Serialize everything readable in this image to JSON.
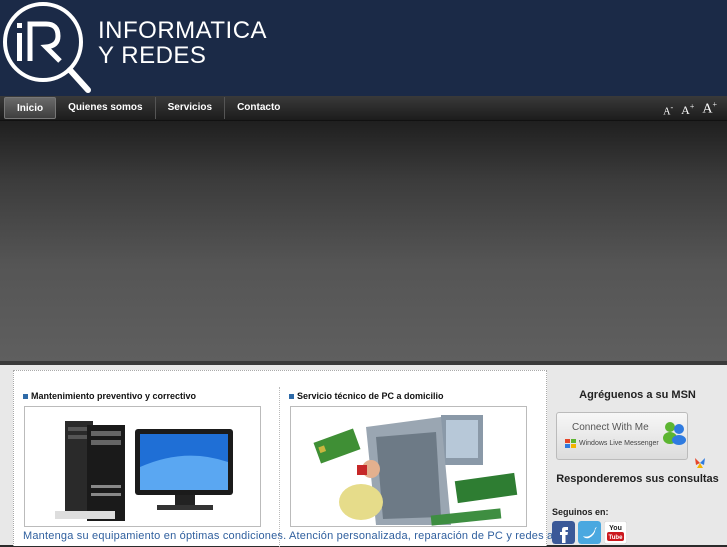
{
  "header": {
    "logo_mark": "iR",
    "logo_line1": "INFORMATICA",
    "logo_line2": "Y REDES"
  },
  "nav": {
    "items": [
      "Inicio",
      "Quienes somos",
      "Servicios",
      "Contacto"
    ],
    "active": "Inicio"
  },
  "font_size_controls": {
    "small": "A",
    "medium": "A",
    "large": "A"
  },
  "services": [
    {
      "title": "Mantenimiento preventivo y correctivo",
      "description": "Mantenga su equipamiento en óptimas condiciones."
    },
    {
      "title": "Servicio técnico de PC a domicilio",
      "description": "Atención personalizada, reparación de PC y redes a"
    }
  ],
  "sidebar": {
    "msn_title": "Agréguenos a su MSN",
    "msn_button_label": "Connect With Me",
    "msn_button_sub": "Windows Live Messenger",
    "consultas_text": "Responderemos sus consultas",
    "social_title": "Seguinos en:",
    "social_icons": [
      "facebook-icon",
      "twitter-icon",
      "youtube-icon"
    ]
  },
  "colors": {
    "header_bg": "#1b2a47",
    "link_blue": "#2f5f9e"
  }
}
